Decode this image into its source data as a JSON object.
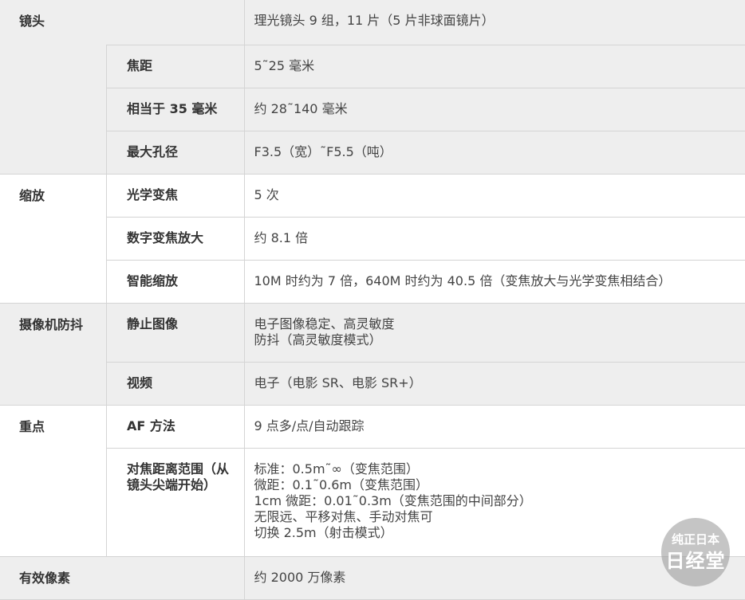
{
  "rows": {
    "lens": {
      "label": "镜头",
      "value": "理光镜头 9 组，11 片（5 片非球面镜片）",
      "focal_length": {
        "label": "焦距",
        "value": "5˜25 毫米"
      },
      "equiv_35mm": {
        "label": "相当于 35 毫米",
        "value": "约 28˜140 毫米"
      },
      "max_aperture": {
        "label": "最大孔径",
        "value": "F3.5（宽）˜F5.5（吨）"
      }
    },
    "zoom": {
      "label": "缩放",
      "optical": {
        "label": "光学变焦",
        "value": "5 次"
      },
      "digital": {
        "label": "数字变焦放大",
        "value": "约 8.1 倍"
      },
      "smart": {
        "label": "智能缩放",
        "value": "10M 时约为 7 倍，640M 时约为 40.5 倍（变焦放大与光学变焦相结合）"
      }
    },
    "stabilization": {
      "label": "摄像机防抖",
      "still": {
        "label": "静止图像",
        "lines": [
          "电子图像稳定、高灵敏度",
          "防抖（高灵敏度模式）"
        ]
      },
      "video": {
        "label": "视频",
        "value": "电子（电影 SR、电影 SR+）"
      }
    },
    "focus": {
      "label": "重点",
      "af_method": {
        "label": "AF 方法",
        "value": "9 点多/点/自动跟踪"
      },
      "range": {
        "label": "对焦距离范围（从镜头尖端开始）",
        "lines": [
          "标准：0.5m˜∞（变焦范围）",
          "微距：0.1˜0.6m（变焦范围）",
          "1cm 微距：0.01˜0.3m（变焦范围的中间部分）",
          "无限远、平移对焦、手动对焦可",
          "切换 2.5m（射击模式）"
        ]
      }
    },
    "pixels": {
      "label": "有效像素",
      "value": "约 2000 万像素"
    }
  }
}
